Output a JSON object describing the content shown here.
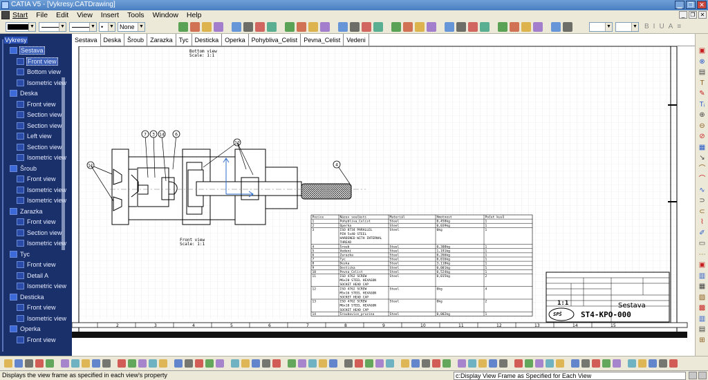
{
  "window": {
    "title": "CATIA V5 - [Vykresy.CATDrawing]"
  },
  "menu": {
    "items": [
      "Start",
      "File",
      "Edit",
      "View",
      "Insert",
      "Tools",
      "Window",
      "Help"
    ]
  },
  "toolbar": {
    "hatch_value": "None"
  },
  "tree": {
    "root": "Vykresy",
    "items": [
      {
        "label": "Sestava",
        "level": 1,
        "selected": true
      },
      {
        "label": "Front view",
        "level": 2,
        "selected": true
      },
      {
        "label": "Bottom view",
        "level": 2
      },
      {
        "label": "Isometric view",
        "level": 2
      },
      {
        "label": "Deska",
        "level": 1
      },
      {
        "label": "Front view",
        "level": 2
      },
      {
        "label": "Section view",
        "level": 2
      },
      {
        "label": "Section view",
        "level": 2
      },
      {
        "label": "Left view",
        "level": 2
      },
      {
        "label": "Section view",
        "level": 2
      },
      {
        "label": "Isometric view",
        "level": 2
      },
      {
        "label": "Šroub",
        "level": 1
      },
      {
        "label": "Front view",
        "level": 2
      },
      {
        "label": "Isometric view",
        "level": 2
      },
      {
        "label": "Isometric view",
        "level": 2
      },
      {
        "label": "Zarazka",
        "level": 1
      },
      {
        "label": "Front view",
        "level": 2
      },
      {
        "label": "Section view",
        "level": 2
      },
      {
        "label": "Isometric view",
        "level": 2
      },
      {
        "label": "Tyc",
        "level": 1
      },
      {
        "label": "Front view",
        "level": 2
      },
      {
        "label": "Detail A",
        "level": 2
      },
      {
        "label": "Isometric view",
        "level": 2
      },
      {
        "label": "Desticka",
        "level": 1
      },
      {
        "label": "Front view",
        "level": 2
      },
      {
        "label": "Isometric view",
        "level": 2
      },
      {
        "label": "Operka",
        "level": 1
      },
      {
        "label": "Front view",
        "level": 2
      }
    ]
  },
  "tabs": [
    "Sestava",
    "Deska",
    "Šroub",
    "Zarazka",
    "Tyc",
    "Desticka",
    "Operka",
    "Pohybliva_Celist",
    "Pevna_Celist",
    "Vedeni"
  ],
  "drawing": {
    "bottom_view_title": "Bottom view",
    "bottom_view_scale": "Scale: 1:1",
    "front_view_title": "Front view",
    "front_view_scale": "Scale: 1:1",
    "balloons": [
      "7",
      "3",
      "14",
      "6",
      "12",
      "11",
      "4"
    ],
    "ruler_numbers": [
      "2",
      "3",
      "4",
      "5",
      "6",
      "7",
      "8",
      "9",
      "10",
      "11",
      "12",
      "13",
      "14",
      "15"
    ],
    "bom_headers": [
      "Pozice",
      "Název součásti",
      "Materiál",
      "Hmotnost",
      "Počet kusů"
    ],
    "bom_rows": [
      [
        "1",
        "Pohybliva_Celist",
        "Steel",
        "0,458kg",
        "1"
      ],
      [
        "2",
        "Operka",
        "Steel",
        "0,039kg",
        "1"
      ],
      [
        "3",
        "ISO 8734 PARALLEL PIN 5x40 STEEL HARDENED WITH INTERNAL THREAD",
        "Steel",
        "0kg",
        "1"
      ],
      [
        "4",
        "Šroub",
        "Steel",
        "0,308kg",
        "1"
      ],
      [
        "5",
        "Vedení",
        "Steel",
        "1,191kg",
        "1"
      ],
      [
        "6",
        "Zarazka",
        "Steel",
        "0,266kg",
        "1"
      ],
      [
        "7",
        "Tyc",
        "Steel",
        "0,016kg",
        "1"
      ],
      [
        "8",
        "Deska",
        "Steel",
        "3,118kg",
        "1"
      ],
      [
        "9",
        "Desticka",
        "Steel",
        "0,001kg",
        "1"
      ],
      [
        "10",
        "Pevna_Celist",
        "Steel",
        "0,524kg",
        "1"
      ],
      [
        "11",
        "ISO 4762 SCREW M6x20 STEEL HEXAGON SOCKET HEAD CAP",
        "Steel",
        "0,015kg",
        "2"
      ],
      [
        "12",
        "ISO 4762 SCREW M5x16 STEEL HEXAGON SOCKET HEAD CAP",
        "Steel",
        "0kg",
        "4"
      ],
      [
        "13",
        "ISO 4762 SCREW M6x18 STEEL HEXAGON SOCKET HEAD CAP",
        "Steel",
        "0kg",
        "2"
      ],
      [
        "14",
        "Šroubovice_pruzina",
        "Steel",
        "0,002kg",
        "1"
      ]
    ],
    "title_block_name": "Sestava",
    "title_block_number": "ST4-KPO-000",
    "title_block_scale": "1:1"
  },
  "status": {
    "message": "Displays the view frame as specified in each view's property",
    "command": "c:Display View Frame as Specified for Each View"
  }
}
